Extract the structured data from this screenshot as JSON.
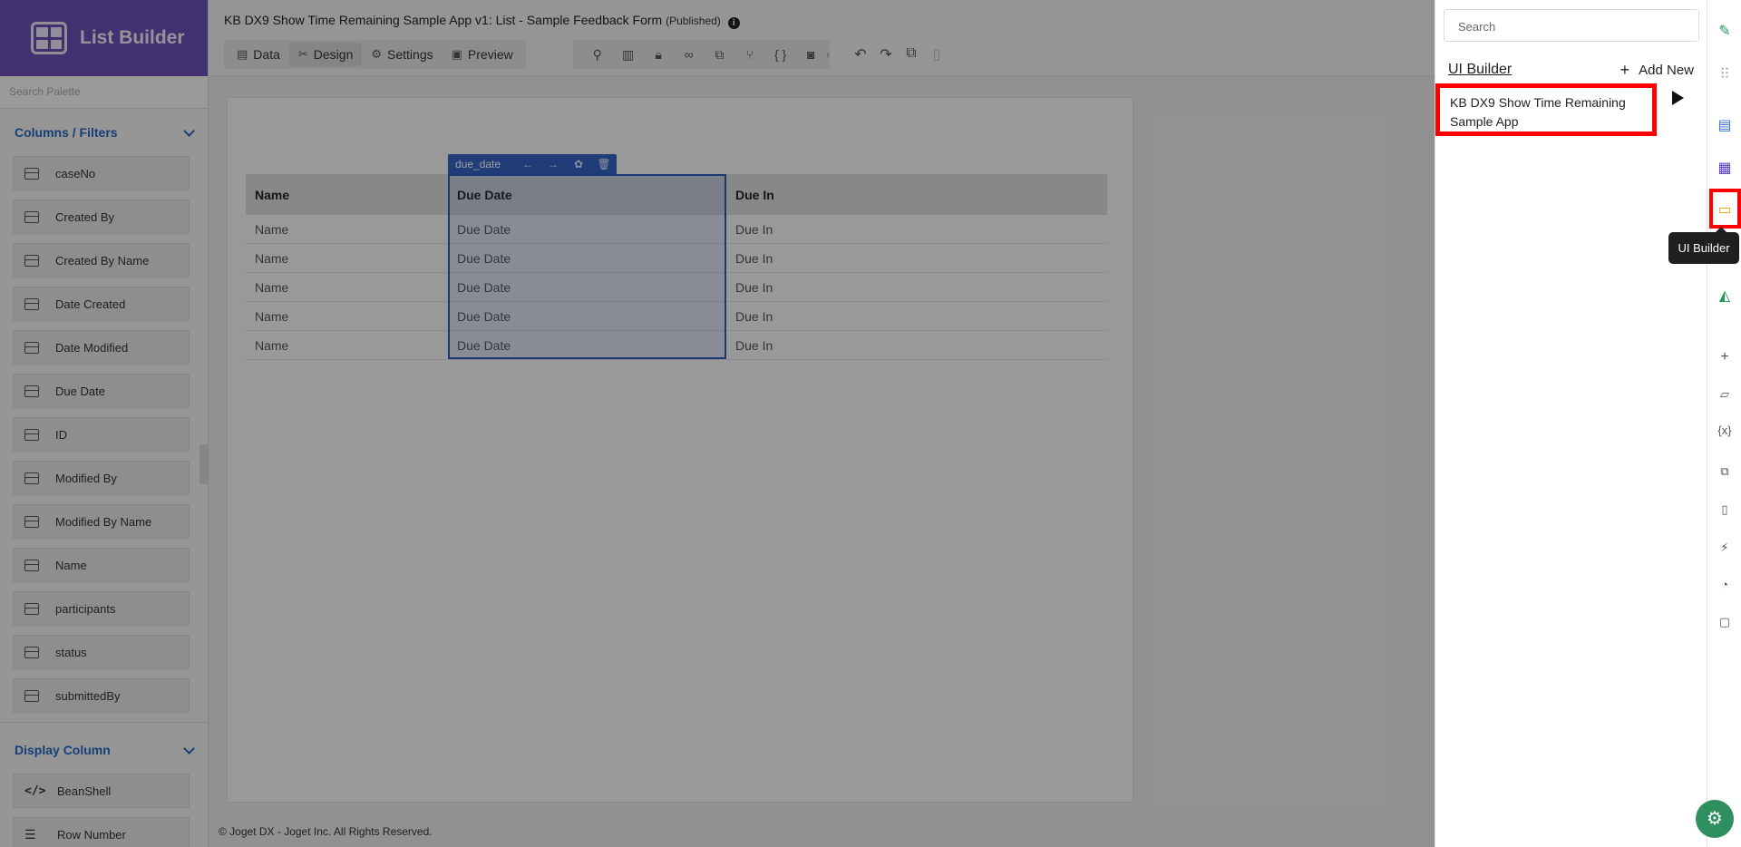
{
  "brand": {
    "title": "List Builder"
  },
  "palette": {
    "search_placeholder": "Search Palette",
    "columns_section": "Columns / Filters",
    "columns": [
      "caseNo",
      "Created By",
      "Created By Name",
      "Date Created",
      "Date Modified",
      "Due Date",
      "ID",
      "Modified By",
      "Modified By Name",
      "Name",
      "participants",
      "status",
      "submittedBy"
    ],
    "display_section": "Display Column",
    "display_items": [
      "BeanShell",
      "Row Number"
    ]
  },
  "header": {
    "title": "KB DX9 Show Time Remaining Sample App v1: List - Sample Feedback Form",
    "status": "(Published)",
    "tabs": [
      "Data",
      "Design",
      "Settings",
      "Preview"
    ],
    "active_tab": "Design"
  },
  "grid": {
    "headers": [
      "Name",
      "Due Date",
      "Due In"
    ],
    "rows": [
      [
        "Name",
        "Due Date",
        "Due In"
      ],
      [
        "Name",
        "Due Date",
        "Due In"
      ],
      [
        "Name",
        "Due Date",
        "Due In"
      ],
      [
        "Name",
        "Due Date",
        "Due In"
      ],
      [
        "Name",
        "Due Date",
        "Due In"
      ]
    ],
    "selected_column_id": "due_date"
  },
  "footer": {
    "text": "© Joget DX - Joget Inc. All Rights Reserved."
  },
  "right_panel": {
    "search_placeholder": "Search",
    "title": "UI Builder",
    "add_new": "Add New",
    "item": "KB DX9 Show Time Remaining Sample App"
  },
  "tooltip": "UI Builder",
  "colors": {
    "brand": "#6a4fb5",
    "highlight": "#ff0000",
    "selection": "#3563c4"
  }
}
